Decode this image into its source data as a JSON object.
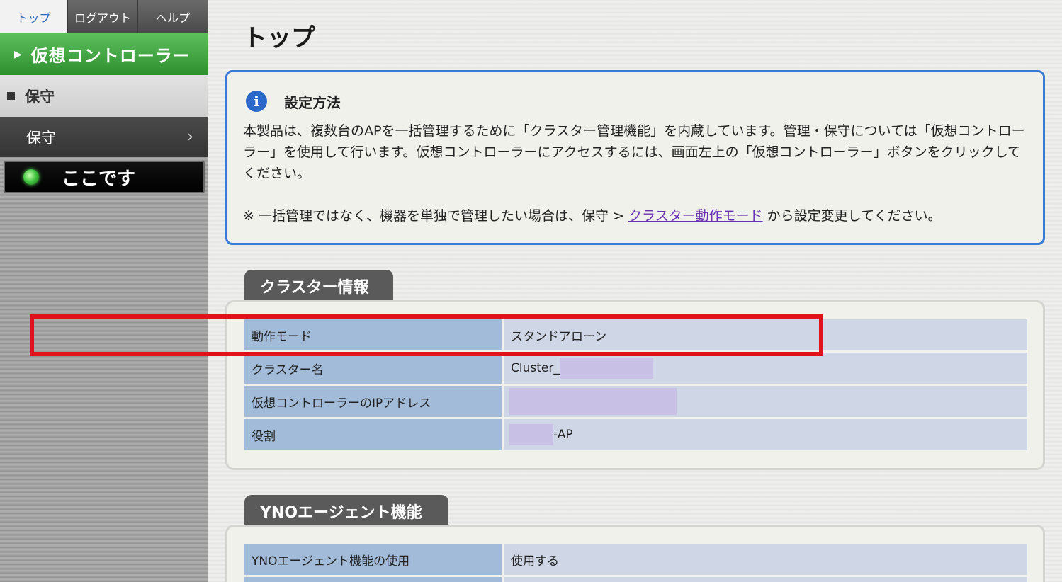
{
  "nav": {
    "tabs": [
      {
        "label": "トップ"
      },
      {
        "label": "ログアウト"
      },
      {
        "label": "ヘルプ"
      }
    ],
    "virtual_controller": "仮想コントローラー",
    "section": "保守",
    "menu_item": "保守",
    "here": "ここです"
  },
  "page": {
    "title": "トップ"
  },
  "info": {
    "title": "設定方法",
    "body": "本製品は、複数台のAPを一括管理するために「クラスター管理機能」を内蔵しています。管理・保守については「仮想コントローラー」を使用して行います。仮想コントローラーにアクセスするには、画面左上の「仮想コントローラー」ボタンをクリックしてください。",
    "note_prefix": "※ 一括管理ではなく、機器を単独で管理したい場合は、保守 > ",
    "note_link": "クラスター動作モード",
    "note_suffix": " から設定変更してください。"
  },
  "cluster": {
    "heading": "クラスター情報",
    "rows": [
      {
        "label": "動作モード",
        "value": "スタンドアローン"
      },
      {
        "label": "クラスター名",
        "value": "Cluster_"
      },
      {
        "label": "仮想コントローラーのIPアドレス",
        "value": ""
      },
      {
        "label": "役割",
        "value": "-AP"
      }
    ]
  },
  "yno": {
    "heading": "YNOエージェント機能",
    "rows": [
      {
        "label": "YNOエージェント機能の使用",
        "value": "使用する"
      }
    ]
  },
  "colors": {
    "accent_green": "#3aa03a",
    "info_border": "#3b79d6",
    "highlight_red": "#e0121b",
    "link_purple": "#6a2fb0"
  }
}
